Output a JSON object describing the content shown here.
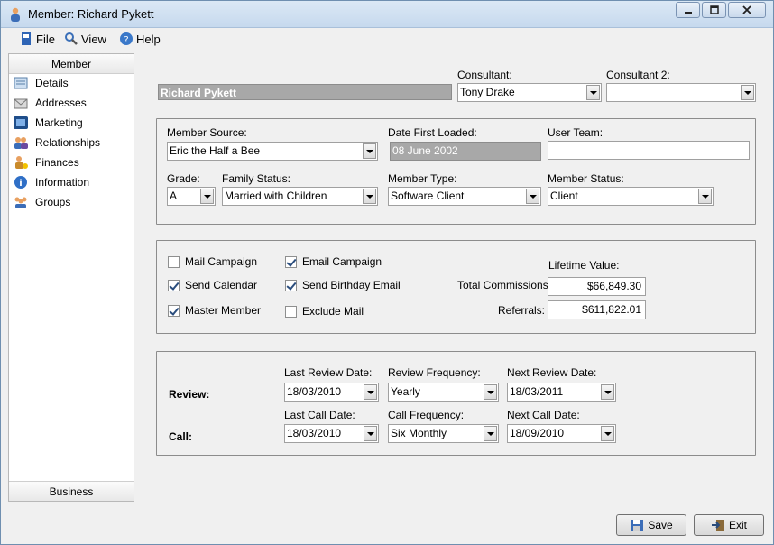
{
  "window": {
    "title": "Member: Richard Pykett"
  },
  "menu": {
    "file": "File",
    "view": "View",
    "help": "Help"
  },
  "sidebar": {
    "header": "Member",
    "footer": "Business",
    "items": [
      {
        "label": "Details",
        "icon": "details-icon"
      },
      {
        "label": "Addresses",
        "icon": "addresses-icon"
      },
      {
        "label": "Marketing",
        "icon": "marketing-icon"
      },
      {
        "label": "Relationships",
        "icon": "relationships-icon"
      },
      {
        "label": "Finances",
        "icon": "finances-icon"
      },
      {
        "label": "Information",
        "icon": "information-icon"
      },
      {
        "label": "Groups",
        "icon": "groups-icon"
      }
    ]
  },
  "member": {
    "name": "Richard Pykett",
    "consultant_label": "Consultant:",
    "consultant": "Tony Drake",
    "consultant2_label": "Consultant 2:",
    "consultant2": ""
  },
  "details": {
    "source_label": "Member Source:",
    "source": "Eric the Half a Bee",
    "date_loaded_label": "Date First Loaded:",
    "date_loaded": "08 June 2002",
    "user_team_label": "User Team:",
    "user_team": "",
    "grade_label": "Grade:",
    "grade": "A",
    "family_label": "Family Status:",
    "family": "Married with Children",
    "type_label": "Member Type:",
    "type": "Software Client",
    "status_label": "Member Status:",
    "status": "Client"
  },
  "marketing": {
    "mail_campaign": {
      "label": "Mail Campaign",
      "checked": false
    },
    "send_calendar": {
      "label": "Send Calendar",
      "checked": true
    },
    "master_member": {
      "label": "Master Member",
      "checked": true
    },
    "email_campaign": {
      "label": "Email Campaign",
      "checked": true
    },
    "send_birthday_email": {
      "label": "Send Birthday Email",
      "checked": true
    },
    "exclude_mail": {
      "label": "Exclude Mail",
      "checked": false
    },
    "lifetime_label": "Lifetime Value:",
    "commissions_label": "Total Commissions:",
    "commissions": "$66,849.30",
    "referrals_label": "Referrals:",
    "referrals": "$611,822.01"
  },
  "review": {
    "review_label": "Review:",
    "call_label": "Call:",
    "last_review_label": "Last Review Date:",
    "last_review": "18/03/2010",
    "review_freq_label": "Review Frequency:",
    "review_freq": "Yearly",
    "next_review_label": "Next Review Date:",
    "next_review": "18/03/2011",
    "last_call_label": "Last Call Date:",
    "last_call": "18/03/2010",
    "call_freq_label": "Call Frequency:",
    "call_freq": "Six Monthly",
    "next_call_label": "Next Call Date:",
    "next_call": "18/09/2010"
  },
  "buttons": {
    "save": "Save",
    "exit": "Exit"
  }
}
